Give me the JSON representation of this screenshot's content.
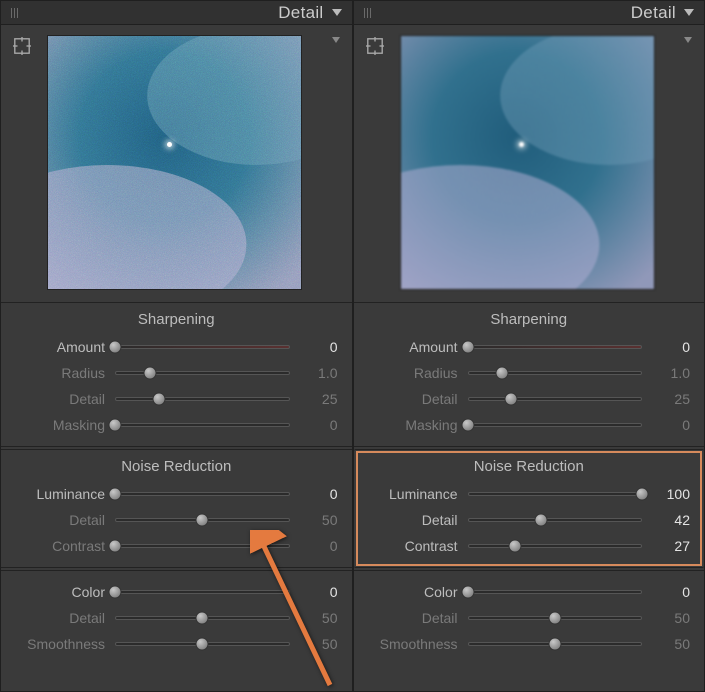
{
  "panels": [
    {
      "title": "Detail",
      "noise_style": "heavy",
      "highlight_noise": false,
      "sharpening": {
        "title": "Sharpening",
        "rows": [
          {
            "name": "amount",
            "label": "Amount",
            "value": "0",
            "pos": 0,
            "track": "red",
            "dimmed": false
          },
          {
            "name": "radius",
            "label": "Radius",
            "value": "1.0",
            "pos": 20,
            "track": "",
            "dimmed": true
          },
          {
            "name": "detail",
            "label": "Detail",
            "value": "25",
            "pos": 25,
            "track": "",
            "dimmed": true
          },
          {
            "name": "masking",
            "label": "Masking",
            "value": "0",
            "pos": 0,
            "track": "",
            "dimmed": true
          }
        ]
      },
      "noise": {
        "title": "Noise Reduction",
        "rows": [
          {
            "name": "luminance",
            "label": "Luminance",
            "value": "0",
            "pos": 0,
            "track": "",
            "dimmed": false
          },
          {
            "name": "detail",
            "label": "Detail",
            "value": "50",
            "pos": 50,
            "track": "",
            "dimmed": true
          },
          {
            "name": "contrast",
            "label": "Contrast",
            "value": "0",
            "pos": 0,
            "track": "",
            "dimmed": true
          }
        ]
      },
      "color": {
        "rows": [
          {
            "name": "color",
            "label": "Color",
            "value": "0",
            "pos": 0,
            "track": "",
            "dimmed": false
          },
          {
            "name": "detail",
            "label": "Detail",
            "value": "50",
            "pos": 50,
            "track": "",
            "dimmed": true
          },
          {
            "name": "smoothness",
            "label": "Smoothness",
            "value": "50",
            "pos": 50,
            "track": "",
            "dimmed": true
          }
        ]
      }
    },
    {
      "title": "Detail",
      "noise_style": "light",
      "highlight_noise": true,
      "sharpening": {
        "title": "Sharpening",
        "rows": [
          {
            "name": "amount",
            "label": "Amount",
            "value": "0",
            "pos": 0,
            "track": "red",
            "dimmed": false
          },
          {
            "name": "radius",
            "label": "Radius",
            "value": "1.0",
            "pos": 20,
            "track": "",
            "dimmed": true
          },
          {
            "name": "detail",
            "label": "Detail",
            "value": "25",
            "pos": 25,
            "track": "",
            "dimmed": true
          },
          {
            "name": "masking",
            "label": "Masking",
            "value": "0",
            "pos": 0,
            "track": "",
            "dimmed": true
          }
        ]
      },
      "noise": {
        "title": "Noise Reduction",
        "rows": [
          {
            "name": "luminance",
            "label": "Luminance",
            "value": "100",
            "pos": 100,
            "track": "",
            "dimmed": false
          },
          {
            "name": "detail",
            "label": "Detail",
            "value": "42",
            "pos": 42,
            "track": "",
            "dimmed": false
          },
          {
            "name": "contrast",
            "label": "Contrast",
            "value": "27",
            "pos": 27,
            "track": "",
            "dimmed": false
          }
        ]
      },
      "color": {
        "rows": [
          {
            "name": "color",
            "label": "Color",
            "value": "0",
            "pos": 0,
            "track": "",
            "dimmed": false
          },
          {
            "name": "detail",
            "label": "Detail",
            "value": "50",
            "pos": 50,
            "track": "",
            "dimmed": true
          },
          {
            "name": "smoothness",
            "label": "Smoothness",
            "value": "50",
            "pos": 50,
            "track": "",
            "dimmed": true
          }
        ]
      }
    }
  ]
}
